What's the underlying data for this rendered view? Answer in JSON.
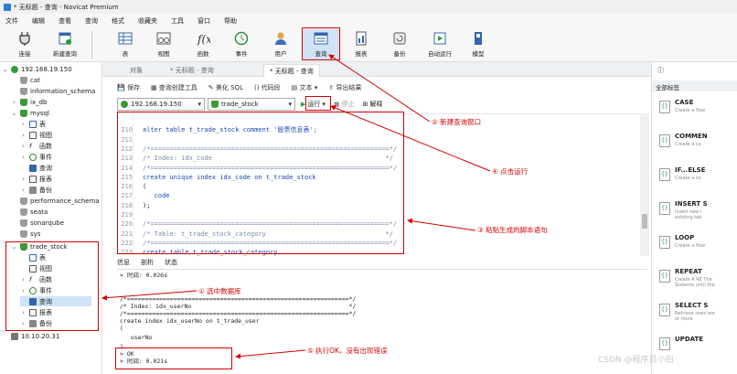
{
  "window": {
    "title": "* 无标题 - 查询 - Navicat Premium"
  },
  "menu": [
    "文件",
    "编辑",
    "查看",
    "查询",
    "格式",
    "收藏夹",
    "工具",
    "窗口",
    "帮助"
  ],
  "toolbar": [
    "连接",
    "新建查询",
    "表",
    "视图",
    "函数",
    "事件",
    "用户",
    "查询",
    "报表",
    "备份",
    "自动运行",
    "模型"
  ],
  "tree": {
    "conn1": "192.168.19.150",
    "dbs_top": [
      "cat",
      "information_schema",
      "ix_db",
      "mysql"
    ],
    "mysql_children": [
      "表",
      "视图",
      "函数",
      "事件",
      "查询",
      "报表",
      "备份"
    ],
    "dbs_mid": [
      "performance_schema",
      "seata",
      "sonarqube",
      "sys",
      "trade_stock"
    ],
    "trade_children": [
      "表",
      "视图",
      "函数",
      "事件",
      "查询",
      "报表",
      "备份"
    ],
    "conn2": "10.10.20.31"
  },
  "tabs": [
    "对象",
    "* 无标题 - 查询",
    "* 无标题 - 查询"
  ],
  "query_toolbar": [
    "保存",
    "查询创建工具",
    "美化 SQL",
    "代码段",
    "文本",
    "导出结果"
  ],
  "selectors": {
    "connection": "192.168.19.150",
    "database": "trade_stock",
    "run": "运行",
    "stop": "停止",
    "explain": "解释"
  },
  "editor": {
    "line_numbers": [
      "210",
      "211",
      "212",
      "213",
      "214",
      "215",
      "216",
      "217",
      "218",
      "219",
      "220",
      "221",
      "222",
      "223",
      "224",
      "225"
    ],
    "lines": [
      {
        "t": "",
        "c": ""
      },
      {
        "t": "alter table t_trade_stock comment '股票信息表';",
        "c": "kw"
      },
      {
        "t": "",
        "c": ""
      },
      {
        "t": "/*==============================================================*/",
        "c": "cm"
      },
      {
        "t": "/* Index: idx_code                                             */",
        "c": "cm"
      },
      {
        "t": "/*==============================================================*/",
        "c": "cm"
      },
      {
        "t": "create unique index idx_code on t_trade_stock",
        "c": "kw"
      },
      {
        "t": "(",
        "c": ""
      },
      {
        "t": "   code",
        "c": "kw"
      },
      {
        "t": ");",
        "c": ""
      },
      {
        "t": "",
        "c": ""
      },
      {
        "t": "/*==============================================================*/",
        "c": "cm"
      },
      {
        "t": "/* Table: t_trade_stock_category                               */",
        "c": "cm"
      },
      {
        "t": "/*==============================================================*/",
        "c": "cm"
      },
      {
        "t": "create table t_trade_stock_category",
        "c": "kw"
      },
      {
        "t": "(",
        "c": ""
      },
      {
        "t": "   id                   bigint not null auto_increment  comment '主键标识',",
        "c": "kw"
      }
    ]
  },
  "output_tabs": [
    "信息",
    "剖析",
    "状态"
  ],
  "output": [
    "> 时间: 0.026s",
    "",
    "",
    "/*==============================================================*/",
    "/* Index: idx_userNo                                            */",
    "/*==============================================================*/",
    "create index idx_userNo on t_trade_user",
    "(",
    "   userNo",
    ")",
    "> OK",
    "> 时间: 0.021s"
  ],
  "right_panel": {
    "header": "全部标签",
    "snippets": [
      {
        "title": "CASE",
        "desc": "Create a flow"
      },
      {
        "title": "COMMEN",
        "desc": "Create a co"
      },
      {
        "title": "IF...ELSE",
        "desc": "Create a co"
      },
      {
        "title": "INSERT S",
        "desc": "Insert new r existing tab"
      },
      {
        "title": "LOOP",
        "desc": "Create a flow"
      },
      {
        "title": "REPEAT",
        "desc": "Create A RE The Stateme until the sea expression i"
      },
      {
        "title": "SELECT S",
        "desc": "Retrieve rows ore or more"
      },
      {
        "title": "UPDATE",
        "desc": ""
      }
    ]
  },
  "annotations": {
    "a1": "① 选中数据库",
    "a2": "② 新建查询窗口",
    "a3": "③ 粘贴生成的脚本语句",
    "a4": "④ 点击运行",
    "a5": "⑤ 执行OK，没有出现错误"
  },
  "watermark": "CSDN @程序员小田"
}
